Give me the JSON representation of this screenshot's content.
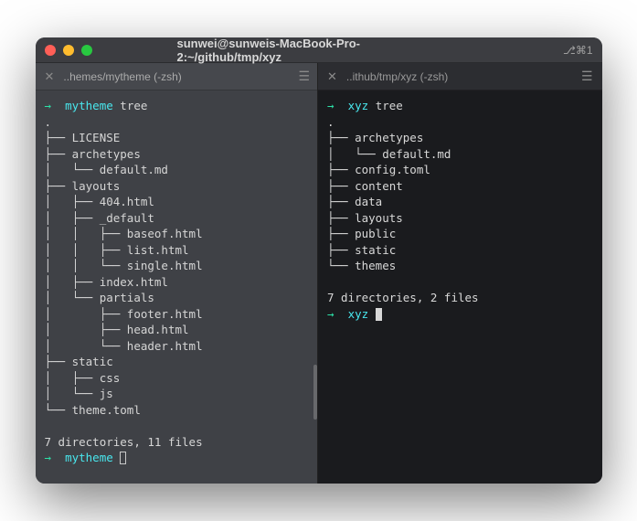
{
  "titlebar": {
    "title": "sunwei@sunweis-MacBook-Pro-2:~/github/tmp/xyz",
    "right_indicator": "⎇⌘1"
  },
  "left_pane": {
    "tab_label": "..hemes/mytheme (-zsh)",
    "prompt_cwd": "mytheme",
    "command": "tree",
    "tree_output": ".\n├── LICENSE\n├── archetypes\n│   └── default.md\n├── layouts\n│   ├── 404.html\n│   ├── _default\n│   │   ├── baseof.html\n│   │   ├── list.html\n│   │   └── single.html\n│   ├── index.html\n│   └── partials\n│       ├── footer.html\n│       ├── head.html\n│       └── header.html\n├── static\n│   ├── css\n│   └── js\n└── theme.toml",
    "summary": "7 directories, 11 files",
    "prompt2_cwd": "mytheme"
  },
  "right_pane": {
    "tab_label": "..ithub/tmp/xyz (-zsh)",
    "prompt_cwd": "xyz",
    "command": "tree",
    "tree_output": ".\n├── archetypes\n│   └── default.md\n├── config.toml\n├── content\n├── data\n├── layouts\n├── public\n├── static\n└── themes",
    "summary": "7 directories, 2 files",
    "prompt2_cwd": "xyz"
  }
}
